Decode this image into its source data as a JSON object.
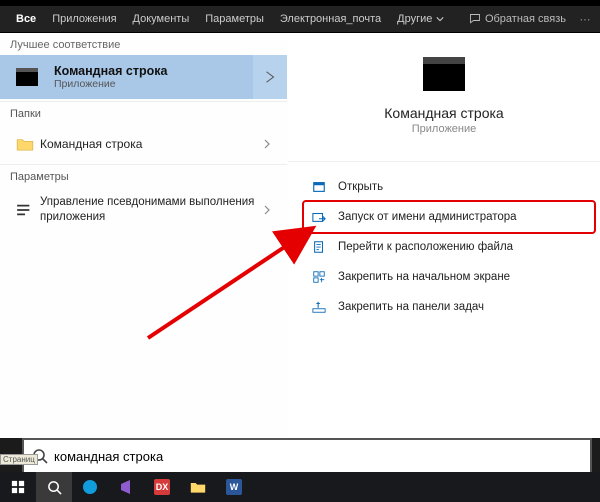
{
  "tabs": {
    "items": [
      "Все",
      "Приложения",
      "Документы",
      "Параметры",
      "Электронная_почта",
      "Другие"
    ],
    "feedback": "Обратная связь"
  },
  "left": {
    "best_header": "Лучшее соответствие",
    "best": {
      "title": "Командная строка",
      "subtitle": "Приложение"
    },
    "folders_header": "Папки",
    "folder_item": "Командная строка",
    "settings_header": "Параметры",
    "settings_item": "Управление псевдонимами выполнения приложения"
  },
  "preview": {
    "title": "Командная строка",
    "subtitle": "Приложение"
  },
  "actions": {
    "open": "Открыть",
    "run_admin": "Запуск от имени администратора",
    "open_location": "Перейти к расположению файла",
    "pin_start": "Закрепить на начальном экране",
    "pin_taskbar": "Закрепить на панели задач"
  },
  "search": {
    "value": "командная строка"
  },
  "misc": {
    "page_label": "Страниц"
  }
}
